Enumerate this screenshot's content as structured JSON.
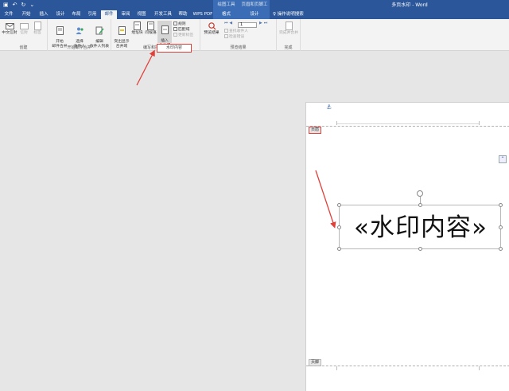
{
  "titlebar": {
    "doc_title": "多页水印 - Word",
    "contextual_1": "绘图工具",
    "contextual_2": "页眉和页脚工具"
  },
  "tabs": [
    {
      "label": "文件"
    },
    {
      "label": "开始"
    },
    {
      "label": "插入"
    },
    {
      "label": "设计"
    },
    {
      "label": "布局"
    },
    {
      "label": "引用"
    },
    {
      "label": "邮件"
    },
    {
      "label": "审阅"
    },
    {
      "label": "视图"
    },
    {
      "label": "开发工具"
    },
    {
      "label": "帮助"
    },
    {
      "label": "WPS PDF"
    },
    {
      "label": "格式"
    },
    {
      "label": "设计"
    }
  ],
  "search_label": "操作说明搜索",
  "ribbon": {
    "create": {
      "label": "创建",
      "chinese_envelope": "中文信封",
      "envelope": "信封",
      "labels": "标签"
    },
    "start_merge": {
      "label": "开始邮件合并",
      "start": "开始\n邮件合并",
      "select": "选择\n收件人",
      "edit": "编辑\n收件人列表"
    },
    "write_insert": {
      "label": "编写和插入域",
      "highlight": "突出显示\n合并域",
      "address": "地址块",
      "greeting": "问候语",
      "insert_merge": "插入\n合并域",
      "rules": "规则",
      "match": "匹配域",
      "update": "更新标签"
    },
    "preview": {
      "label": "预览结果",
      "preview_btn": "预览结果",
      "record": "1",
      "find": "查找收件人",
      "check": "检查错误"
    },
    "finish": {
      "label": "完成",
      "finish_merge": "完成并合并"
    }
  },
  "popup_text": "水印内容",
  "document": {
    "header_tag": "页眉",
    "footer_tag": "页脚",
    "watermark_text": "«水印内容»"
  },
  "colors": {
    "accent": "#2b579a",
    "highlight": "#e0403a"
  }
}
